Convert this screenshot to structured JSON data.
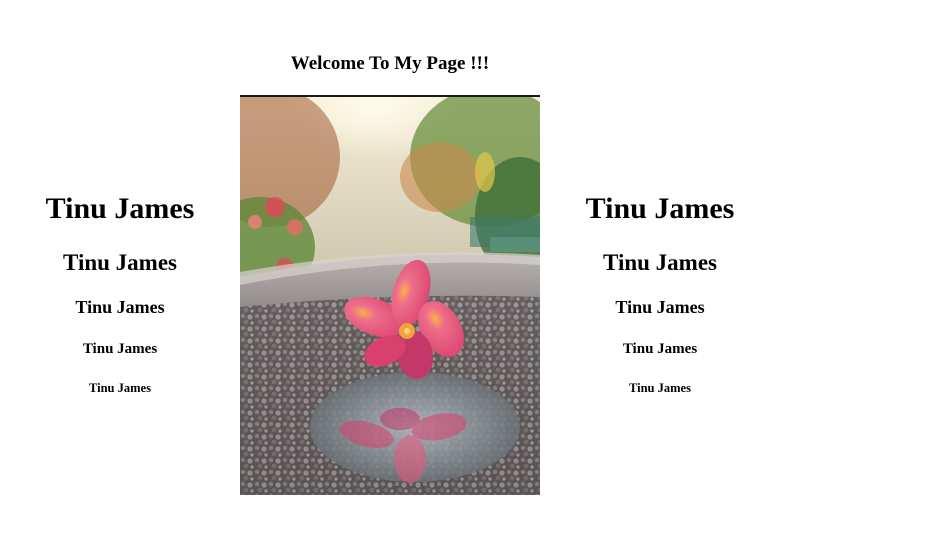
{
  "header": {
    "title": "Welcome To My Page !!!"
  },
  "left_column": {
    "h1": "Tinu James",
    "h2": "Tinu James",
    "h3": "Tinu James",
    "h4": "Tinu James",
    "h5": "Tinu James"
  },
  "right_column": {
    "h1": "Tinu James",
    "h2": "Tinu James",
    "h3": "Tinu James",
    "h4": "Tinu James",
    "h5": "Tinu James"
  },
  "image": {
    "subject": "pink plumeria flower on wet road with reflection",
    "colors": {
      "petal": "#e8577f",
      "petal_light": "#f59ab0",
      "center": "#f2a23a",
      "road": "#6e6a6b",
      "foliage": "#5f8a3a",
      "sky": "#f3ead2"
    }
  }
}
